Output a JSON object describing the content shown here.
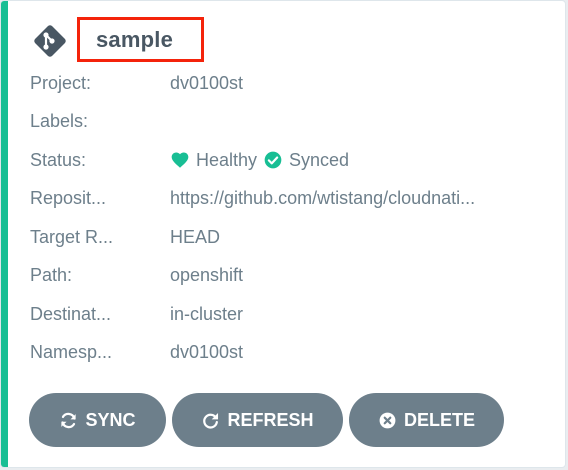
{
  "app": {
    "name": "sample",
    "icon": "git-icon",
    "accent_color": "#18be94",
    "highlight_color": "#f4230b"
  },
  "fields": [
    {
      "label": "Project:",
      "value": "dv0100st"
    },
    {
      "label": "Labels:",
      "value": ""
    },
    {
      "label": "Status:",
      "health": "Healthy",
      "sync": "Synced"
    },
    {
      "label": "Reposit...",
      "value": "https://github.com/wtistang/cloudnati..."
    },
    {
      "label": "Target R...",
      "value": "HEAD"
    },
    {
      "label": "Path:",
      "value": "openshift"
    },
    {
      "label": "Destinat...",
      "value": "in-cluster"
    },
    {
      "label": "Namesp...",
      "value": "dv0100st"
    }
  ],
  "status_colors": {
    "healthy": "#18be94",
    "synced": "#18be94"
  },
  "actions": {
    "sync_label": "SYNC",
    "sync_icon": "sync-icon",
    "refresh_label": "REFRESH",
    "refresh_icon": "redo-icon",
    "delete_label": "DELETE",
    "delete_icon": "times-circle-icon",
    "button_color": "#6d7f8b"
  }
}
